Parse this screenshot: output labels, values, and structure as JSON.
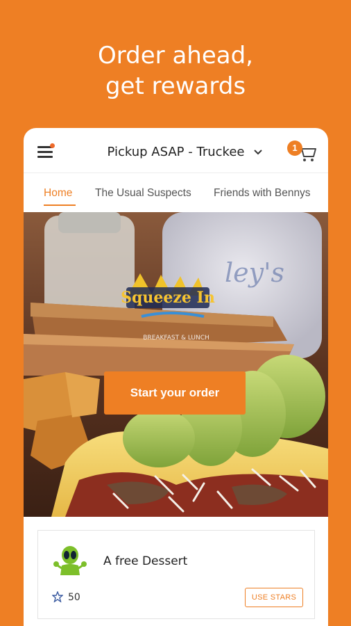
{
  "headline": {
    "line1": "Order ahead,",
    "line2": "get rewards"
  },
  "header": {
    "location": "Pickup ASAP - Truckee",
    "cart_count": "1"
  },
  "tabs": [
    {
      "label": "Home",
      "active": true
    },
    {
      "label": "The Usual Suspects",
      "active": false
    },
    {
      "label": "Friends with Bennys",
      "active": false
    }
  ],
  "hero": {
    "cta_label": "Start your order",
    "logo_text": "Squeeze In",
    "logo_sub": "BREAKFAST & LUNCH"
  },
  "reward": {
    "title": "A free Dessert",
    "stars": "50",
    "button_label": "USE STARS"
  },
  "colors": {
    "brand": "#ee7f24"
  }
}
